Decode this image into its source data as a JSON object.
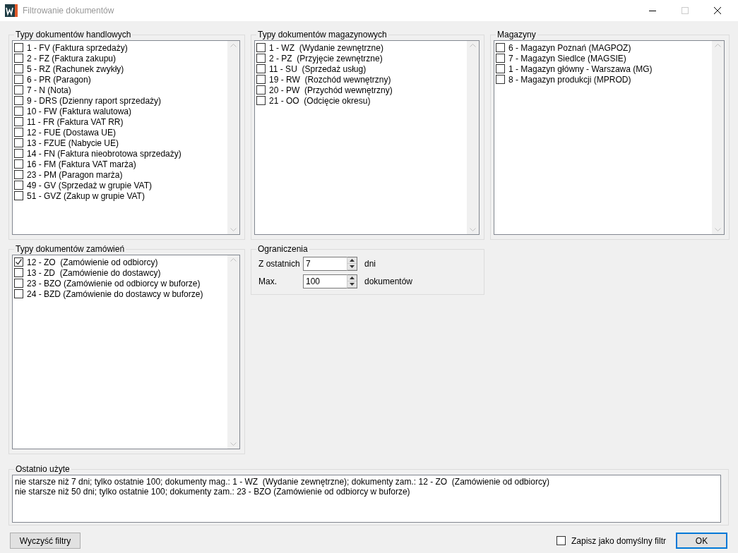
{
  "window": {
    "title": "Filtrowanie dokumentów"
  },
  "groups": [
    {
      "title": "Typy dokumentów handlowych",
      "items": [
        {
          "label": "1 - FV (Faktura sprzedaży)",
          "checked": false
        },
        {
          "label": "2 - FZ (Faktura zakupu)",
          "checked": false
        },
        {
          "label": "5 - RZ (Rachunek zwykły)",
          "checked": false
        },
        {
          "label": "6 - PR (Paragon)",
          "checked": false
        },
        {
          "label": "7 - N (Nota)",
          "checked": false
        },
        {
          "label": "9 - DRS (Dzienny raport sprzedaży)",
          "checked": false
        },
        {
          "label": "10 - FW (Faktura walutowa)",
          "checked": false
        },
        {
          "label": "11 - FR (Faktura VAT RR)",
          "checked": false
        },
        {
          "label": "12 - FUE (Dostawa UE)",
          "checked": false
        },
        {
          "label": "13 - FZUE (Nabycie UE)",
          "checked": false
        },
        {
          "label": "14 - FN (Faktura nieobrotowa sprzedaży)",
          "checked": false
        },
        {
          "label": "16 - FM (Faktura VAT marża)",
          "checked": false
        },
        {
          "label": "23 - PM (Paragon marża)",
          "checked": false
        },
        {
          "label": "49 - GV (Sprzedaż w grupie VAT)",
          "checked": false
        },
        {
          "label": "51 - GVZ (Zakup w grupie VAT)",
          "checked": false
        }
      ]
    },
    {
      "title": "Typy dokumentów magazynowych",
      "items": [
        {
          "label": "1 - WZ  (Wydanie zewnętrzne)",
          "checked": false
        },
        {
          "label": "2 - PZ  (Przyjęcie zewnętrzne)",
          "checked": false
        },
        {
          "label": "11 - SU  (Sprzedaż usług)",
          "checked": false
        },
        {
          "label": "19 - RW  (Rozchód wewnętrzny)",
          "checked": false
        },
        {
          "label": "20 - PW  (Przychód wewnętrzny)",
          "checked": false
        },
        {
          "label": "21 - OO  (Odcięcie okresu)",
          "checked": false
        }
      ]
    },
    {
      "title": "Magazyny",
      "items": [
        {
          "label": "6 - Magazyn Poznań (MAGPOZ)",
          "checked": false
        },
        {
          "label": "7 - Magazyn Siedlce (MAGSIE)",
          "checked": false
        },
        {
          "label": "1 - Magazyn główny - Warszawa (MG)",
          "checked": false
        },
        {
          "label": "8 - Magazyn produkcji (MPROD)",
          "checked": false
        }
      ]
    },
    {
      "title": "Typy dokumentów zamówień",
      "items": [
        {
          "label": "12 - ZO  (Zamówienie od odbiorcy)",
          "checked": true
        },
        {
          "label": "13 - ZD  (Zamówienie do dostawcy)",
          "checked": false
        },
        {
          "label": "23 - BZO (Zamówienie od odbiorcy w buforze)",
          "checked": false
        },
        {
          "label": "24 - BZD (Zamówienie do dostawcy w buforze)",
          "checked": false
        }
      ]
    }
  ],
  "limits": {
    "title": "Ograniczenia",
    "fields": [
      {
        "label": "Z ostatnich",
        "value": "7",
        "unit": "dni"
      },
      {
        "label": "Max.",
        "value": "100",
        "unit": "dokumentów"
      }
    ]
  },
  "recent": {
    "title": "Ostatnio użyte",
    "lines": [
      "nie starsze niż 7 dni; tylko ostatnie 100; dokumenty mag.: 1 - WZ  (Wydanie zewnętrzne); dokumenty zam.: 12 - ZO  (Zamówienie od odbiorcy)",
      "nie starsze niż 50 dni; tylko ostatnie 100; dokumenty zam.: 23 - BZO (Zamówienie od odbiorcy w buforze)"
    ]
  },
  "clear_button": "Wyczyść filtry",
  "save_default": {
    "label": "Zapisz jako domyślny filtr",
    "checked": false
  },
  "ok_button": "OK"
}
